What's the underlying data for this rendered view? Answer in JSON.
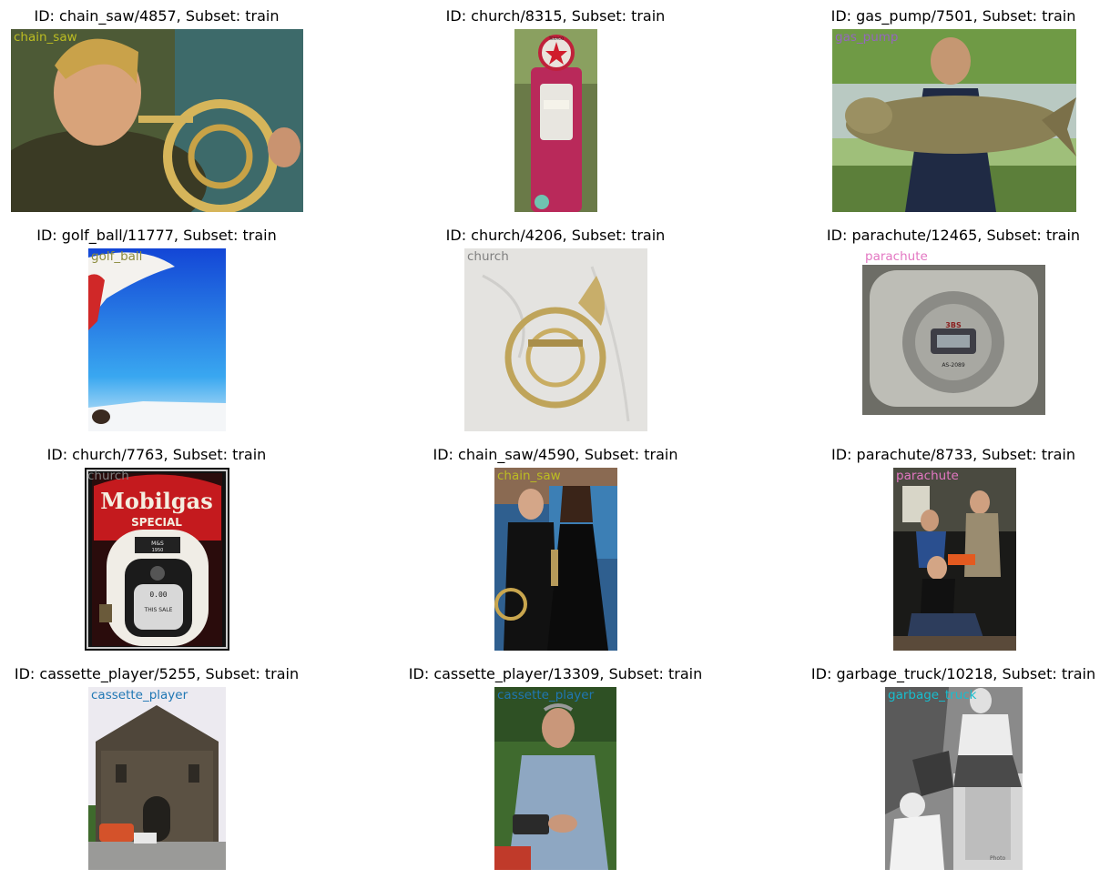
{
  "panels": [
    {
      "title": "ID: chain_saw/4857, Subset: train",
      "label": "chain_saw",
      "label_color": "#bcbd22"
    },
    {
      "title": "ID: church/8315, Subset: train",
      "label": "",
      "label_color": ""
    },
    {
      "title": "ID: gas_pump/7501, Subset: train",
      "label": "gas_pump",
      "label_color": "#9467bd"
    },
    {
      "title": "ID: golf_ball/11777, Subset: train",
      "label": "golf_ball",
      "label_color": "#8c8c3c"
    },
    {
      "title": "ID: church/4206, Subset: train",
      "label": "church",
      "label_color": "#7f7f7f"
    },
    {
      "title": "ID: parachute/12465, Subset: train",
      "label": "parachute",
      "label_color": "#e377c2"
    },
    {
      "title": "ID: church/7763, Subset: train",
      "label": "church",
      "label_color": "#7f7f7f"
    },
    {
      "title": "ID: chain_saw/4590, Subset: train",
      "label": "chain_saw",
      "label_color": "#bcbd22"
    },
    {
      "title": "ID: parachute/8733, Subset: train",
      "label": "parachute",
      "label_color": "#e377c2"
    },
    {
      "title": "ID: cassette_player/5255, Subset: train",
      "label": "cassette_player",
      "label_color": "#1f77b4"
    },
    {
      "title": "ID: cassette_player/13309, Subset: train",
      "label": "cassette_player",
      "label_color": "#1f77b4"
    },
    {
      "title": "ID: garbage_truck/10218, Subset: train",
      "label": "garbage_truck",
      "label_color": "#17becf"
    }
  ],
  "image_text": {
    "texaco": "TEXACO",
    "mobilgas": "Mobilgas",
    "special": "SPECIAL",
    "ms": "M&S",
    "ms_year": "1950",
    "counter": "0.00",
    "this_sale": "THIS SALE",
    "brand_3bs": "3BS",
    "model": "AS-2089",
    "photo_credit": "Photo"
  }
}
